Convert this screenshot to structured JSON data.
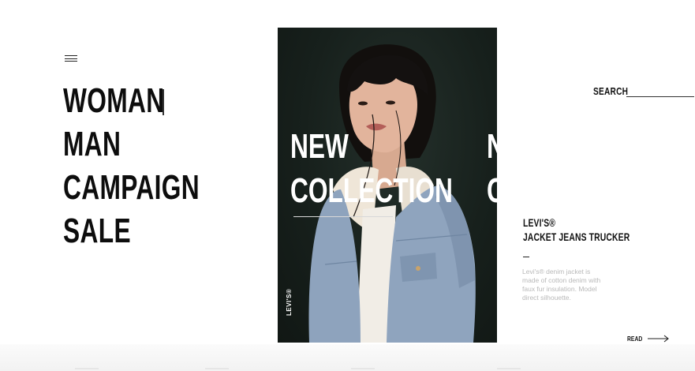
{
  "nav": {
    "items": [
      {
        "label": "WOMAN"
      },
      {
        "label": "MAN"
      },
      {
        "label": "CAMPAIGN"
      },
      {
        "label": "SALE"
      }
    ]
  },
  "hero": {
    "title_line1": "NEW",
    "title_line2": "COLLECTION",
    "next_title_line1": "NEW",
    "next_title_line2": "COLLECTION",
    "brand_vertical": "LEVI'S®"
  },
  "search": {
    "label": "SEARCH",
    "value": "",
    "placeholder": ""
  },
  "product": {
    "brand": "LEVI'S®",
    "name": "JACKET JEANS TRUCKER",
    "description": "Levi's® denim jacket is made of cotton denim with faux fur insulation. Model direct silhouette."
  },
  "read": {
    "label": "READ"
  },
  "colors": {
    "card_background": "#17201c",
    "text": "#111111",
    "muted_text": "#b9b9b9",
    "denim": "#8ea3bd"
  },
  "icons": {
    "menu": "hamburger-icon",
    "read_arrow": "arrow-right-icon"
  }
}
